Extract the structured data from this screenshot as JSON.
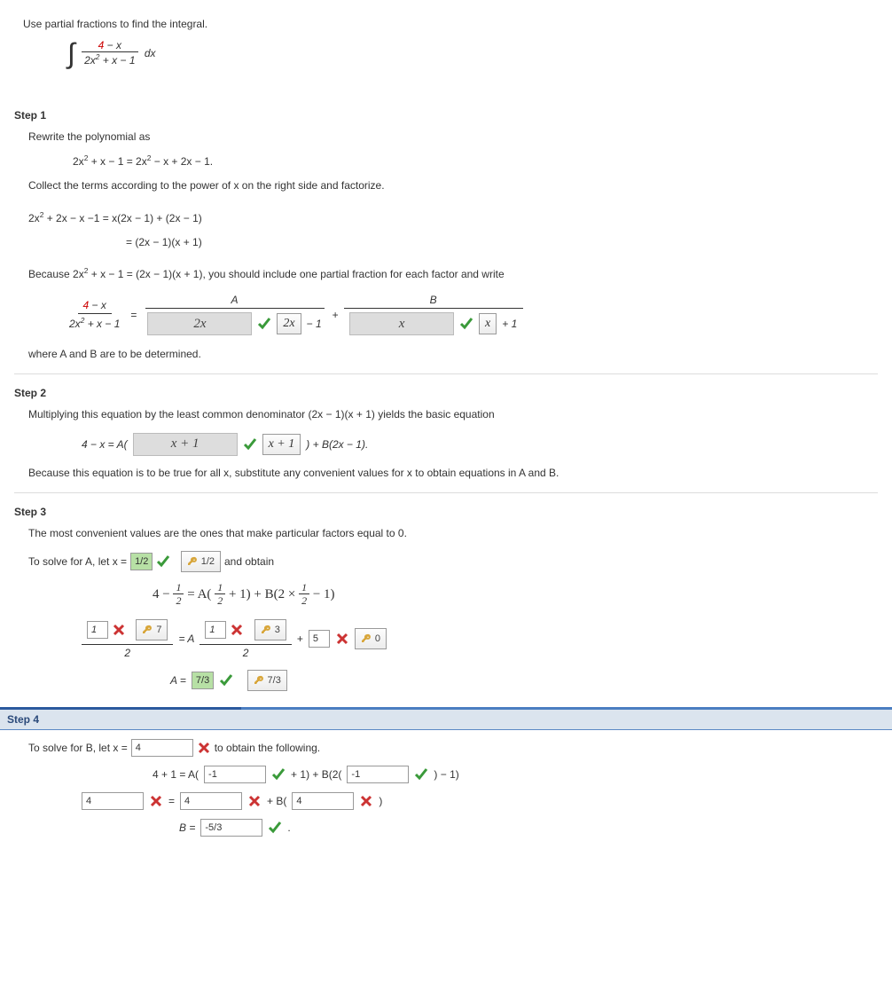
{
  "prompt": "Use partial fractions to find the integral.",
  "integral": {
    "num_l": "4",
    "num_r": "x",
    "den_l": "2x",
    "den_exp": "2",
    "den_r": " + x − 1",
    "dx": "dx"
  },
  "step1": {
    "title": "Step 1",
    "l1": "Rewrite the polynomial as",
    "eq1_l": "2x",
    "eq1_exp": "2",
    "eq1_mid": " + x − 1 = 2x",
    "eq1_exp2": "2",
    "eq1_r": " − x + 2x − 1.",
    "l2": "Collect the terms according to the power of x on the right side and factorize.",
    "eq2_l": "2x",
    "eq2_exp": "2",
    "eq2_r": " + 2x − x −1 = x(2x − 1) + (2x − 1)",
    "eq3": "= (2x − 1)(x + 1)",
    "l3a": "Because  2x",
    "l3exp": "2",
    "l3b": " + x − 1 = (2x − 1)(x + 1),  you should include one partial fraction for each factor and write",
    "fr_num_l": "4",
    "fr_num_r": "x",
    "fr_den_l": "2x",
    "fr_den_exp": "2",
    "fr_den_r": " + x − 1",
    "A": "A",
    "B": "B",
    "eq": "=",
    "plus": "+",
    "m1": "− 1",
    "p1": "+ 1",
    "ans2x": "2x",
    "ansx": "x",
    "hint2x": "2x",
    "hintx": "x",
    "l4": "where A and B are to be determined."
  },
  "step2": {
    "title": "Step 2",
    "l1": "Multiplying this equation by the least common denominator  (2x − 1)(x + 1)  yields the basic equation",
    "lhs": "4 − x = A( ",
    "ans": "x + 1",
    "hint": "x + 1",
    "tail": ") + B(2x − 1).",
    "l2": "Because this equation is to be true for all x, substitute any convenient values for x to obtain equations in A and B."
  },
  "step3": {
    "title": "Step 3",
    "l1": "The most convenient values are the ones that make particular factors equal to 0.",
    "l2a": "To solve for A, let  x = ",
    "val_half": "1/2",
    "l2b": "  and obtain",
    "disp": "4 − ",
    "half": "1",
    "two": "2",
    "eqA": " = A(",
    "plus1": " + 1) + B(2 × ",
    "m1": " − 1)",
    "r2_eq": "= A",
    "r2_plus": "+",
    "r2_den": "2",
    "box1": "1",
    "k7": "7",
    "box1b": "1",
    "k3": "3",
    "box5": "5",
    "k0": "0",
    "l3": "A = ",
    "ans73": "7/3",
    "k73": "7/3"
  },
  "step4": {
    "title": "Step 4",
    "l1a": "To solve for B, let x = ",
    "v4": "4",
    "l1b": "  to obtain the following.",
    "r1_l": "4 + 1 = A( ",
    "vN1": "-1",
    "r1_m": " + 1) + B(2( ",
    "vN1b": "-1",
    "r1_r": " ) − 1)",
    "r2_a": "4",
    "r2_eq": " = ",
    "r2_b": "4",
    "r2_mid": " + B( ",
    "r2_c": "4",
    "r2_r": " )",
    "r3_l": "B = ",
    "vB": "-5/3",
    "r3_r": " ."
  }
}
